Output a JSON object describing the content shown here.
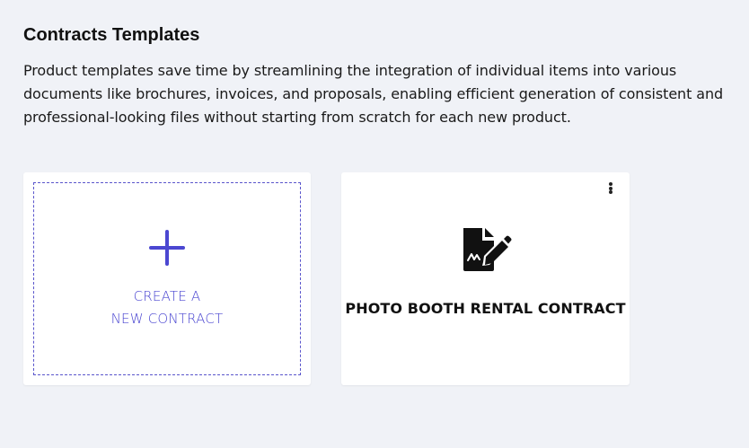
{
  "header": {
    "title": "Contracts Templates",
    "description": "Product templates save time by streamlining the integration of individual items into various documents like brochures, invoices, and proposals, enabling efficient generation of consistent and professional-looking files without starting from scratch for each new product."
  },
  "create_card": {
    "line1": "CREATE A",
    "line2": "NEW CONTRACT",
    "icon": "plus-icon"
  },
  "templates": [
    {
      "title": "PHOTO BOOTH RENTAL CONTRACT",
      "icon": "file-signature-icon",
      "menu_icon": "kebab-menu-icon"
    }
  ],
  "colors": {
    "background": "#f0f2f7",
    "accent": "#4b47d1",
    "card": "#ffffff"
  }
}
